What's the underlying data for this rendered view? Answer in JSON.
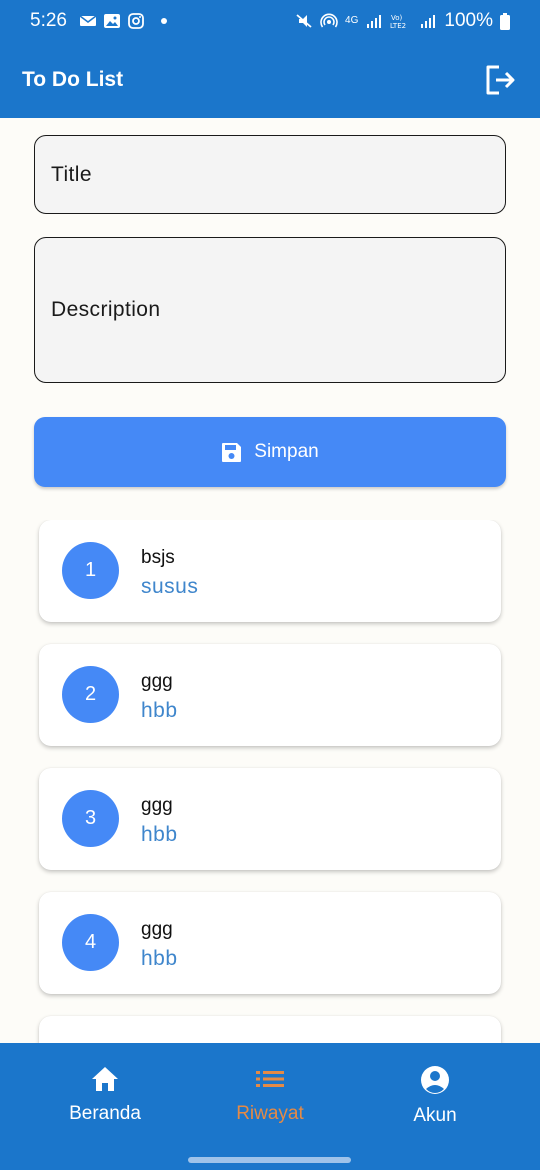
{
  "status_bar": {
    "time": "5:26",
    "battery": "100%",
    "network": "4G"
  },
  "app_bar": {
    "title": "To Do List",
    "logout_icon": "logout-icon"
  },
  "form": {
    "title_placeholder": "Title",
    "description_placeholder": "Description",
    "save_label": "Simpan",
    "save_icon": "save-icon"
  },
  "todos": [
    {
      "number": "1",
      "title": "bsjs",
      "description": "susus"
    },
    {
      "number": "2",
      "title": "ggg",
      "description": "hbb"
    },
    {
      "number": "3",
      "title": "ggg",
      "description": "hbb"
    },
    {
      "number": "4",
      "title": "ggg",
      "description": "hbb"
    }
  ],
  "bottom_nav": {
    "items": [
      {
        "label": "Beranda",
        "icon": "home-icon",
        "active": false
      },
      {
        "label": "Riwayat",
        "icon": "list-icon",
        "active": true
      },
      {
        "label": "Akun",
        "icon": "account-icon",
        "active": false
      }
    ],
    "active_color": "#e58a45"
  },
  "colors": {
    "primary": "#1b76cb",
    "button": "#4589f6",
    "description_text": "#3f86cc"
  }
}
